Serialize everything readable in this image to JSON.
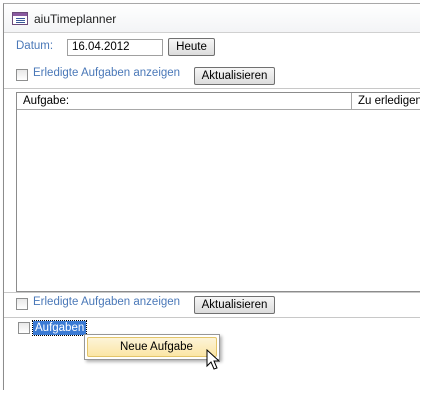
{
  "window": {
    "title": "aiuTimeplanner",
    "icon": "form-icon"
  },
  "filter": {
    "date_label": "Datum:",
    "date_value": "16.04.2012",
    "today_button": "Heute"
  },
  "top_section": {
    "show_done_label": "Erledigte Aufgaben anzeigen",
    "show_done_checked": false,
    "refresh_button": "Aktualisieren"
  },
  "task_list": {
    "columns": [
      "Aufgabe:",
      "Zu erledigen"
    ],
    "rows": []
  },
  "bottom_section": {
    "show_done_label": "Erledigte Aufgaben anzeigen",
    "show_done_checked": false,
    "refresh_button": "Aktualisieren"
  },
  "tree": {
    "root_label": "Aufgaben",
    "root_checked": false,
    "selected": true
  },
  "context_menu": {
    "items": [
      "Neue Aufgabe"
    ]
  },
  "colors": {
    "label_blue": "#4a78b8",
    "selection_blue": "#3b7bd4",
    "menu_highlight": "#fbe6a6"
  }
}
